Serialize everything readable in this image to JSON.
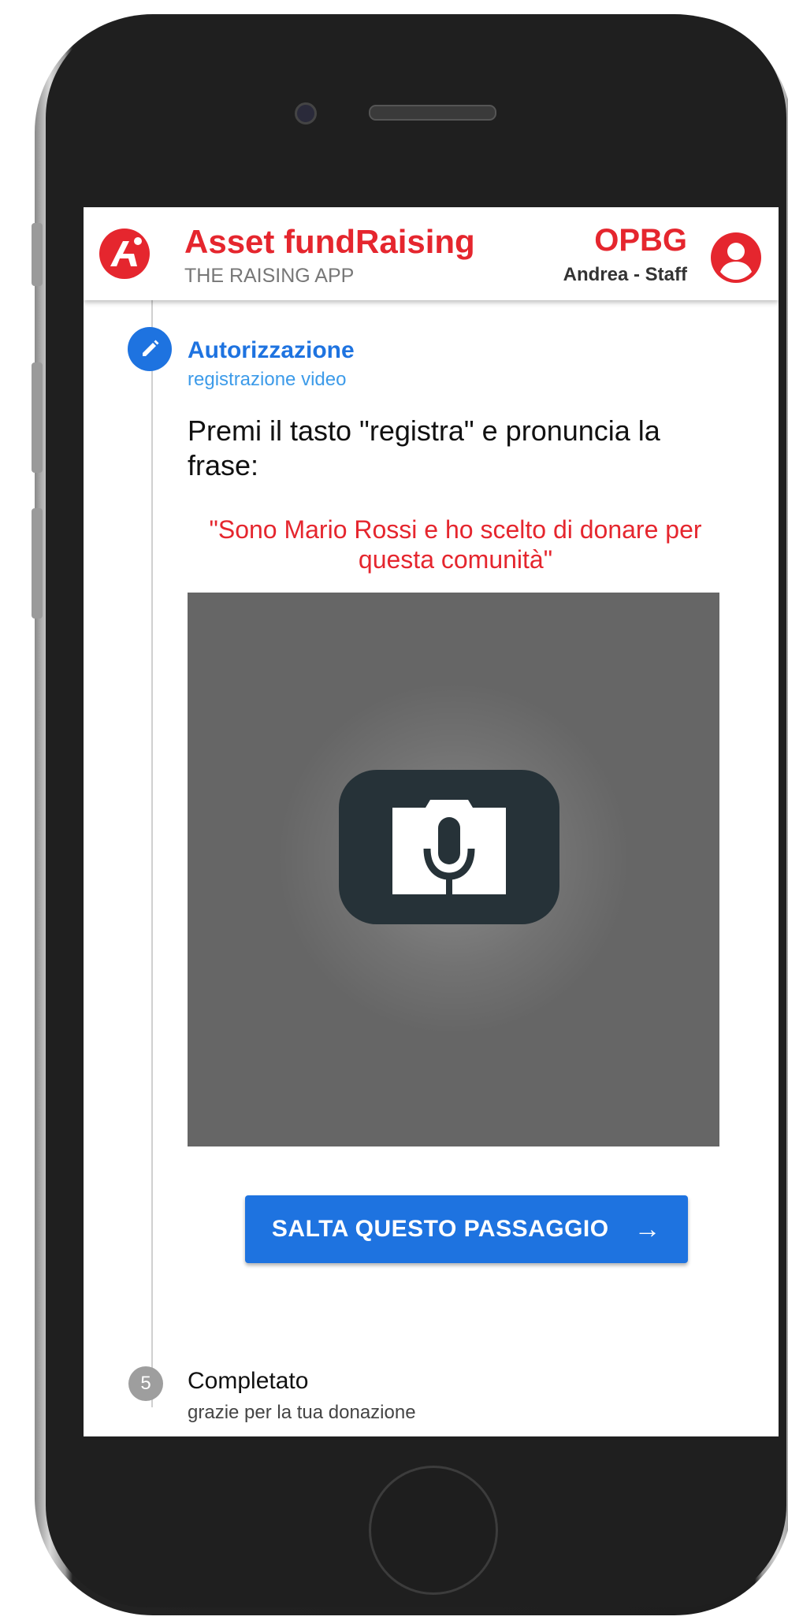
{
  "header": {
    "app_title": "Asset fundRaising",
    "app_subtitle": "THE RAISING APP",
    "org": "OPBG",
    "user": "Andrea - Staff"
  },
  "stepper": {
    "current_step": {
      "title": "Autorizzazione",
      "subtitle": "registrazione video",
      "icon": "pencil-icon"
    },
    "instruction": "Premi il tasto \"registra\" e pronuncia la frase:",
    "phrase": "\"Sono Mario Rossi e ho scelto di donare per questa comunità\"",
    "record_icon": "camera-microphone-icon",
    "skip_label": "SALTA QUESTO PASSAGGIO",
    "skip_icon": "arrow-right-icon",
    "next_step": {
      "number": "5",
      "title": "Completato",
      "subtitle": "grazie per la tua donazione"
    }
  },
  "colors": {
    "brand_red": "#e5262e",
    "primary_blue": "#1e73e0",
    "video_bg": "#666666",
    "record_button": "#263238"
  }
}
